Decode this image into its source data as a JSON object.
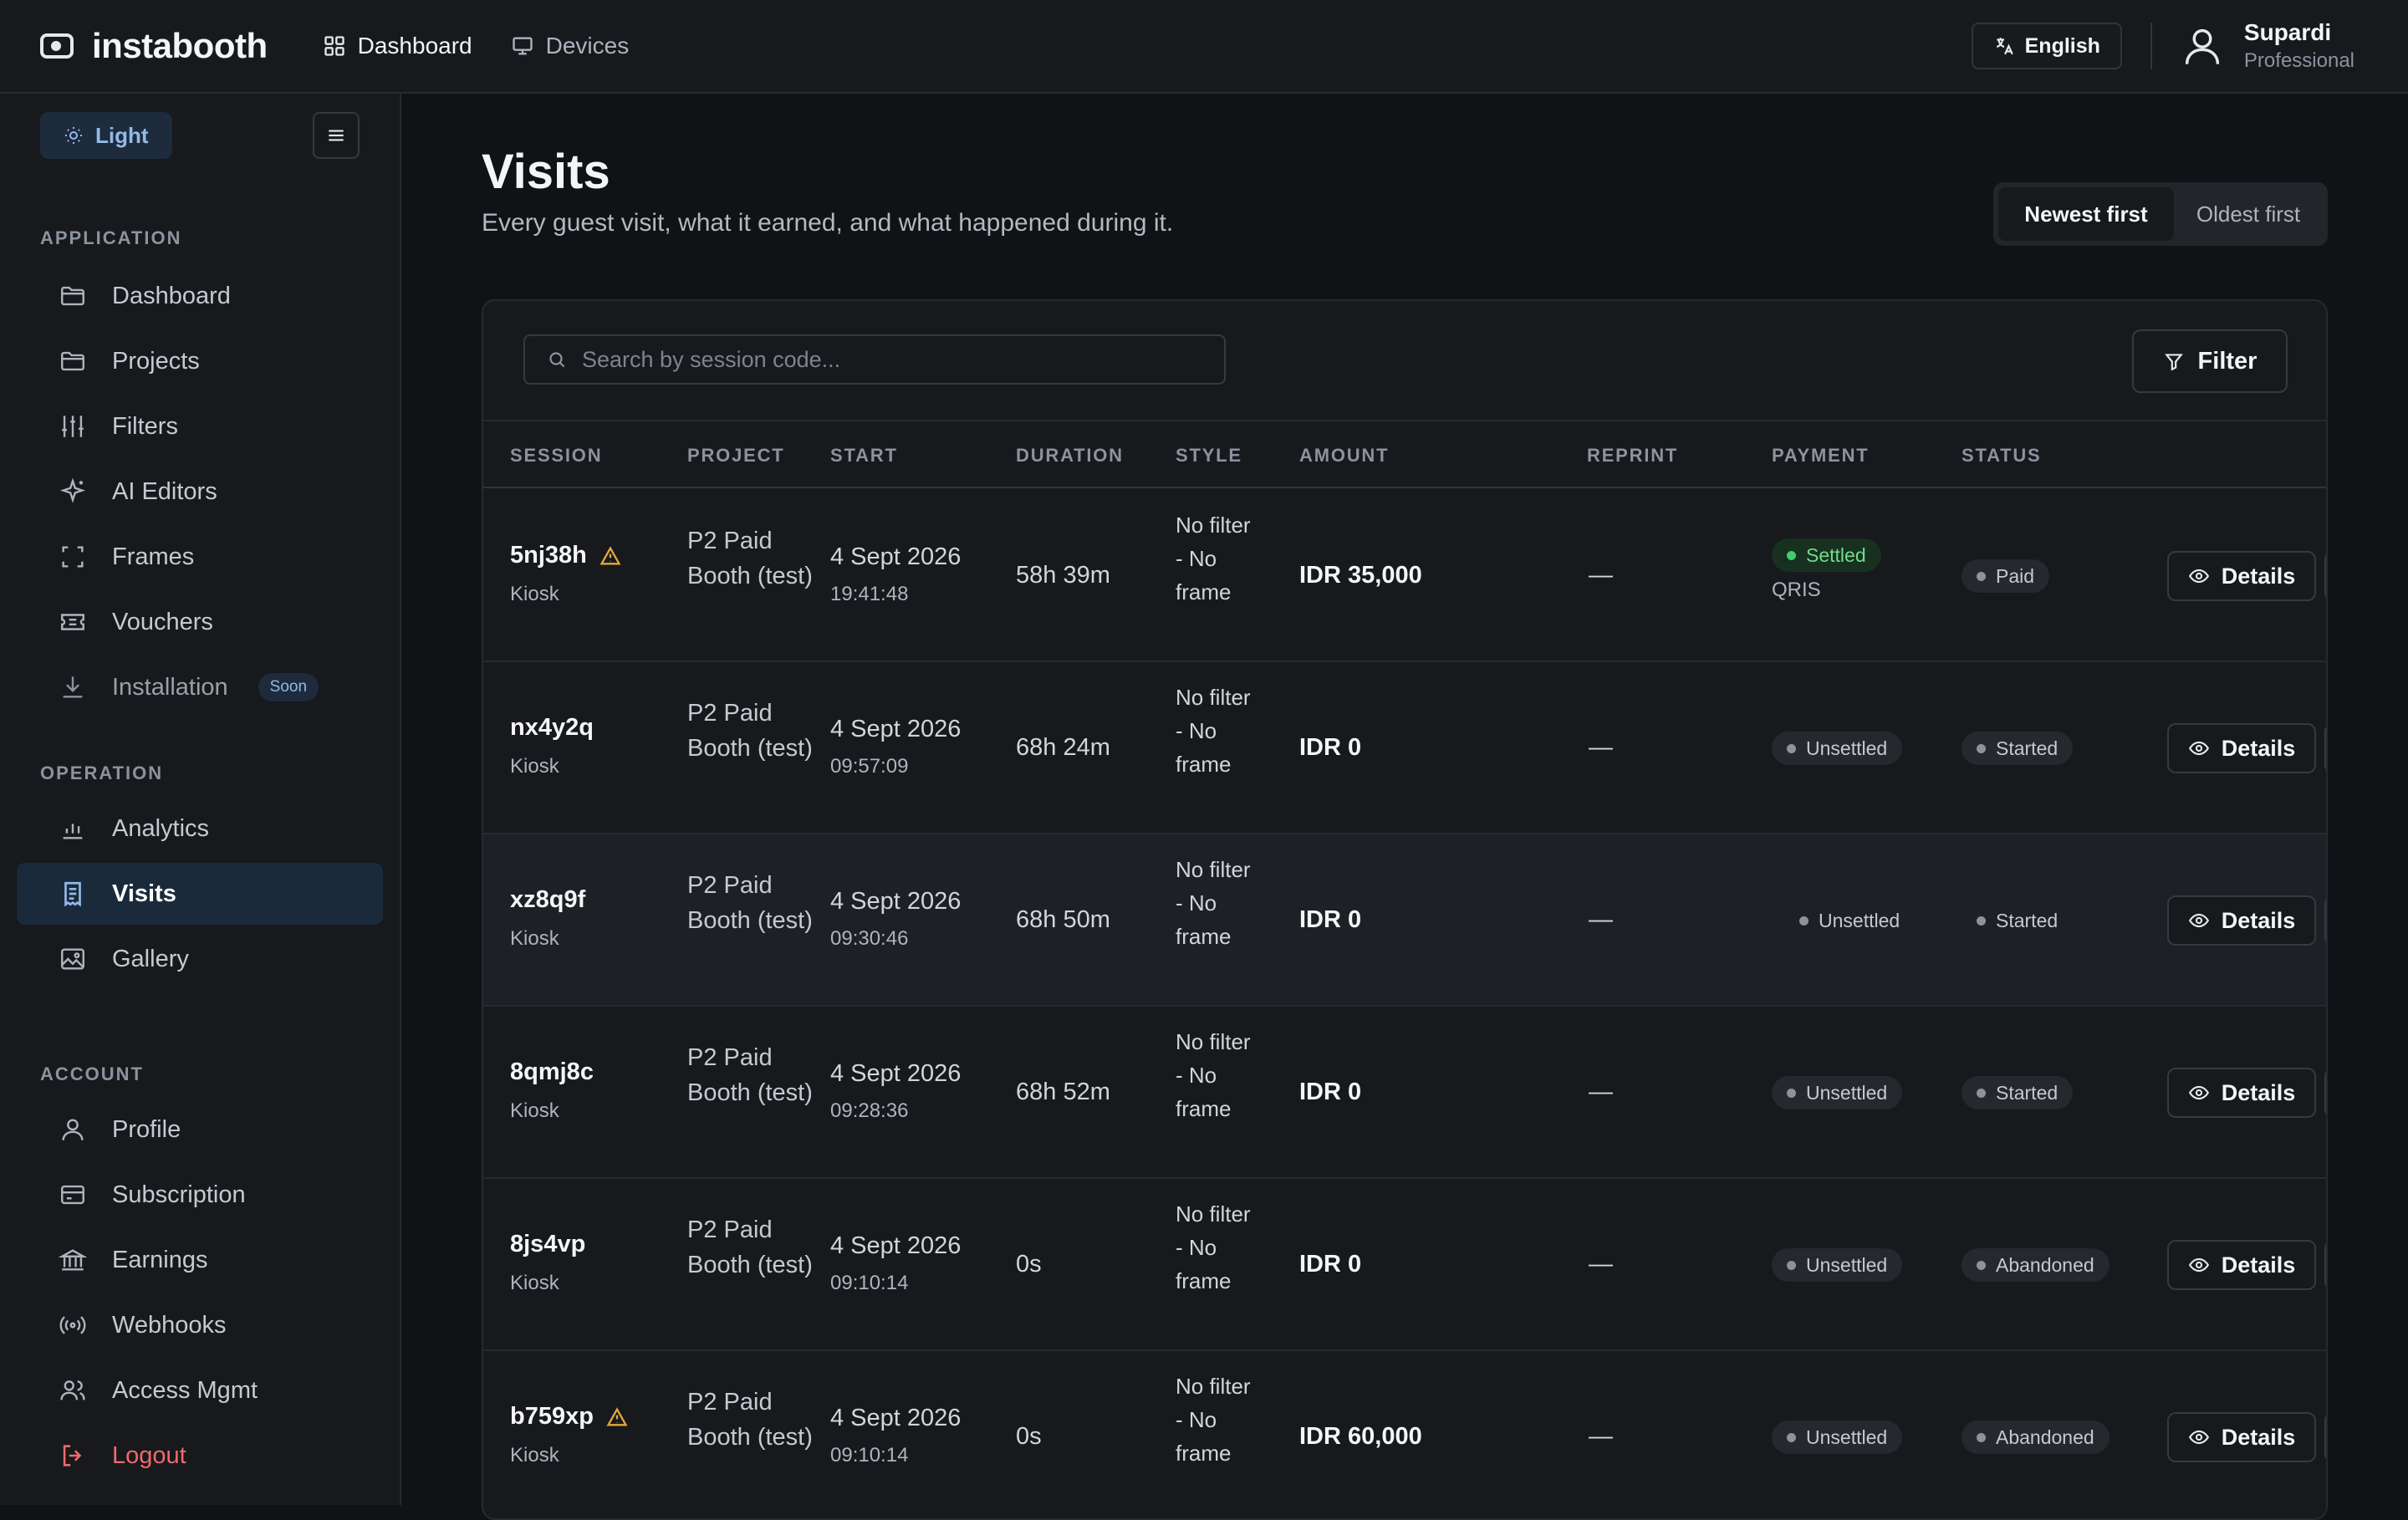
{
  "app": {
    "name": "instabooth"
  },
  "topnav": {
    "items": [
      {
        "label": "Dashboard",
        "icon": "grid-icon",
        "active": true
      },
      {
        "label": "Devices",
        "icon": "monitor-icon",
        "active": false
      }
    ]
  },
  "language": {
    "label": "English"
  },
  "user": {
    "name": "Supardi",
    "plan": "Professional"
  },
  "sidebar": {
    "theme_label": "Light",
    "sections": {
      "application": "APPLICATION",
      "operation": "OPERATION",
      "account": "ACCOUNT"
    },
    "application_items": [
      {
        "label": "Dashboard",
        "icon": "folder-icon"
      },
      {
        "label": "Projects",
        "icon": "folder-icon"
      },
      {
        "label": "Filters",
        "icon": "sliders-icon"
      },
      {
        "label": "AI Editors",
        "icon": "sparkle-icon"
      },
      {
        "label": "Frames",
        "icon": "frame-icon"
      },
      {
        "label": "Vouchers",
        "icon": "ticket-icon"
      },
      {
        "label": "Installation",
        "icon": "download-icon",
        "badge": "Soon"
      }
    ],
    "operation_items": [
      {
        "label": "Analytics",
        "icon": "bar-chart-icon"
      },
      {
        "label": "Visits",
        "icon": "receipt-icon",
        "active": true
      },
      {
        "label": "Gallery",
        "icon": "image-icon"
      }
    ],
    "account_items": [
      {
        "label": "Profile",
        "icon": "user-icon"
      },
      {
        "label": "Subscription",
        "icon": "credit-card-icon"
      },
      {
        "label": "Earnings",
        "icon": "bank-icon"
      },
      {
        "label": "Webhooks",
        "icon": "broadcast-icon"
      },
      {
        "label": "Access Mgmt",
        "icon": "users-icon"
      },
      {
        "label": "Logout",
        "icon": "logout-icon",
        "danger": true
      }
    ]
  },
  "page": {
    "title": "Visits",
    "subtitle": "Every guest visit, what it earned, and what happened during it.",
    "sort": {
      "newest": "Newest first",
      "oldest": "Oldest first",
      "selected": "Newest first"
    }
  },
  "toolbar": {
    "search_placeholder": "Search by session code...",
    "search_value": "",
    "filter_label": "Filter"
  },
  "table": {
    "columns": [
      "SESSION",
      "PROJECT",
      "START",
      "DURATION",
      "STYLE",
      "AMOUNT",
      "REPRINT",
      "PAYMENT",
      "STATUS"
    ],
    "details_label": "Details",
    "rows": [
      {
        "session": "5nj38h",
        "warning": true,
        "source": "Kiosk",
        "project": "P2 Paid Booth (test)",
        "date": "4 Sept 2026",
        "time": "19:41:48",
        "duration": "58h 39m",
        "style": "No filter - No frame",
        "amount": "IDR 35,000",
        "reprint": "—",
        "payment": "Settled",
        "payment_method": "QRIS",
        "status": "Paid"
      },
      {
        "session": "nx4y2q",
        "warning": false,
        "source": "Kiosk",
        "project": "P2 Paid Booth (test)",
        "date": "4 Sept 2026",
        "time": "09:57:09",
        "duration": "68h 24m",
        "style": "No filter - No frame",
        "amount": "IDR 0",
        "reprint": "—",
        "payment": "Unsettled",
        "payment_method": "",
        "status": "Started"
      },
      {
        "session": "xz8q9f",
        "warning": false,
        "source": "Kiosk",
        "project": "P2 Paid Booth (test)",
        "date": "4 Sept 2026",
        "time": "09:30:46",
        "duration": "68h 50m",
        "style": "No filter - No frame",
        "amount": "IDR 0",
        "reprint": "—",
        "payment": "Unsettled",
        "payment_method": "",
        "status": "Started"
      },
      {
        "session": "8qmj8c",
        "warning": false,
        "source": "Kiosk",
        "project": "P2 Paid Booth (test)",
        "date": "4 Sept 2026",
        "time": "09:28:36",
        "duration": "68h 52m",
        "style": "No filter - No frame",
        "amount": "IDR 0",
        "reprint": "—",
        "payment": "Unsettled",
        "payment_method": "",
        "status": "Started"
      },
      {
        "session": "8js4vp",
        "warning": false,
        "source": "Kiosk",
        "project": "P2 Paid Booth (test)",
        "date": "4 Sept 2026",
        "time": "09:10:14",
        "duration": "0s",
        "style": "No filter - No frame",
        "amount": "IDR 0",
        "reprint": "—",
        "payment": "Unsettled",
        "payment_method": "",
        "status": "Abandoned"
      },
      {
        "session": "b759xp",
        "warning": true,
        "source": "Kiosk",
        "project": "P2 Paid Booth (test)",
        "date": "4 Sept 2026",
        "time": "09:10:14",
        "duration": "0s",
        "style": "No filter - No frame",
        "amount": "IDR 60,000",
        "reprint": "—",
        "payment": "Unsettled",
        "payment_method": "",
        "status": "Abandoned"
      }
    ]
  },
  "colors": {
    "accent": "#93b9e8",
    "active_bg": "#1b2a3b",
    "settled": "#3fcf6c",
    "warning": "#e0a93c",
    "danger": "#f06a6a"
  }
}
